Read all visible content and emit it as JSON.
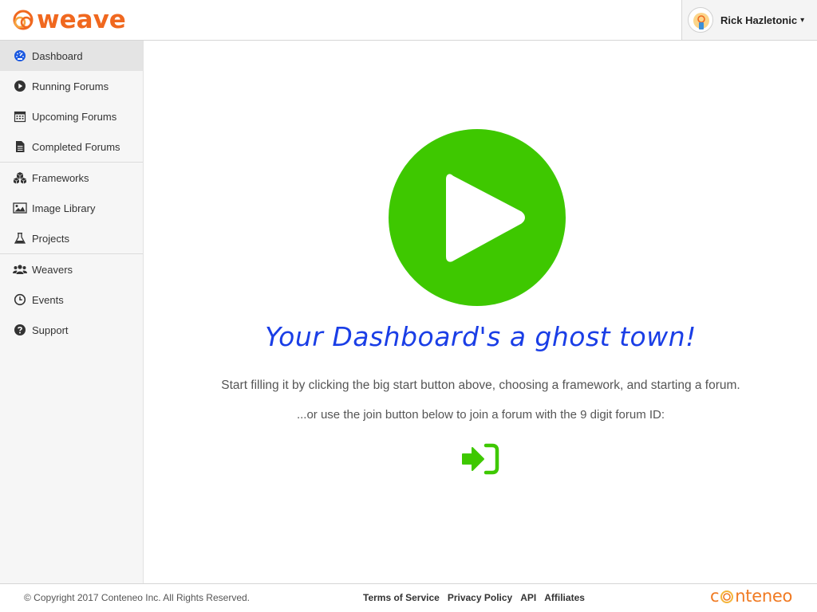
{
  "header": {
    "logo_text": "weave",
    "user_name": "Rick Hazletonic",
    "user_caret": "▾"
  },
  "sidebar": {
    "groups": [
      {
        "items": [
          {
            "label": "Dashboard",
            "icon": "dashboard-icon",
            "active": true
          },
          {
            "label": "Running Forums",
            "icon": "play-circle-icon"
          },
          {
            "label": "Upcoming Forums",
            "icon": "calendar-icon"
          },
          {
            "label": "Completed Forums",
            "icon": "document-icon"
          }
        ]
      },
      {
        "items": [
          {
            "label": "Frameworks",
            "icon": "cubes-icon"
          },
          {
            "label": "Image Library",
            "icon": "image-icon"
          },
          {
            "label": "Projects",
            "icon": "flask-icon"
          }
        ]
      },
      {
        "items": [
          {
            "label": "Weavers",
            "icon": "users-icon"
          },
          {
            "label": "Events",
            "icon": "clock-icon"
          },
          {
            "label": "Support",
            "icon": "question-circle-icon"
          }
        ]
      }
    ]
  },
  "main": {
    "heading": "Your Dashboard's a ghost town!",
    "line1": "Start filling it by clicking the big start button above, choosing a framework, and starting a forum.",
    "line2": "...or use the join button below to join a forum with the 9 digit forum ID:",
    "start_button_icon": "play-circle-icon",
    "join_button_icon": "sign-in-icon",
    "accent_color": "#3ec800"
  },
  "footer": {
    "copyright": "© Copyright 2017 Conteneo Inc. All Rights Reserved.",
    "links": [
      "Terms of Service",
      "Privacy Policy",
      "API",
      "Affiliates"
    ],
    "brand_prefix": "c",
    "brand_suffix": "nteneo"
  },
  "colors": {
    "brand_orange": "#f0681f",
    "heading_blue": "#1a3ee6",
    "green": "#3ec800"
  }
}
